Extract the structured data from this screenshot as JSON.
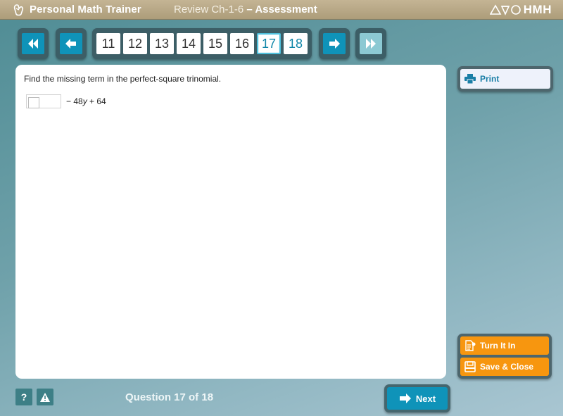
{
  "header": {
    "brand": "Personal Math Trainer",
    "review": "Review Ch-1-6",
    "separator": " – ",
    "assessment": "Assessment",
    "publisher": "HMH"
  },
  "nav": {
    "first_icon": "double-chevron-left-icon",
    "prev_icon": "arrow-left-icon",
    "next_icon": "arrow-right-icon",
    "last_icon": "double-chevron-right-icon",
    "questions": [
      "11",
      "12",
      "13",
      "14",
      "15",
      "16",
      "17",
      "18"
    ],
    "current": "17"
  },
  "content": {
    "prompt": "Find the missing term in the perfect-square trinomial.",
    "answer_value": "",
    "expr_minus": "− 48",
    "expr_var": "y",
    "expr_plus": " + 64"
  },
  "sidebar": {
    "print_label": "Print",
    "turn_in_label": "Turn It In",
    "save_close_label": "Save & Close"
  },
  "footer": {
    "help_label": "?",
    "question_count": "Question 17 of 18",
    "next_label": "Next"
  },
  "colors": {
    "accent_blue": "#0f93b9",
    "orange": "#f7960f",
    "header_tan": "#b8a886"
  }
}
